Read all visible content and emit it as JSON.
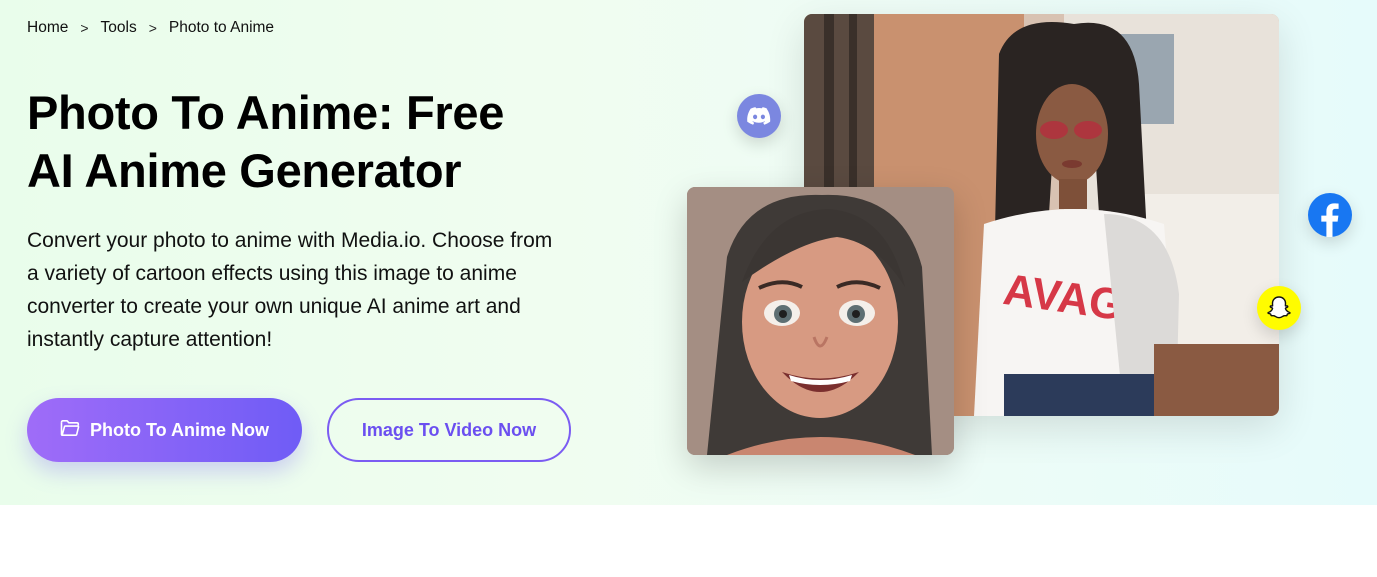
{
  "breadcrumb": {
    "items": [
      "Home",
      "Tools",
      "Photo to Anime"
    ],
    "separator": ">"
  },
  "hero": {
    "title_line1": "Photo To Anime: Free",
    "title_line2": "AI Anime Generator",
    "description": "Convert your photo to anime with Media.io. Choose from a variety of cartoon effects using this image to anime converter to create your own unique AI anime art and instantly capture attention!",
    "primary_button": "Photo To Anime Now",
    "secondary_button": "Image To Video Now"
  },
  "media": {
    "photo_shirt_text": "AVAGE"
  },
  "icons": {
    "primary_button_icon": "folder-open-icon",
    "discord": "discord-icon",
    "facebook": "facebook-icon",
    "snapchat": "snapchat-icon"
  },
  "colors": {
    "accent_gradient_start": "#9f6cf8",
    "accent_gradient_end": "#6f5cf6",
    "secondary_border": "#7b5cf2",
    "discord": "#7b87e0",
    "facebook": "#1877f2",
    "snapchat": "#fffc00"
  }
}
